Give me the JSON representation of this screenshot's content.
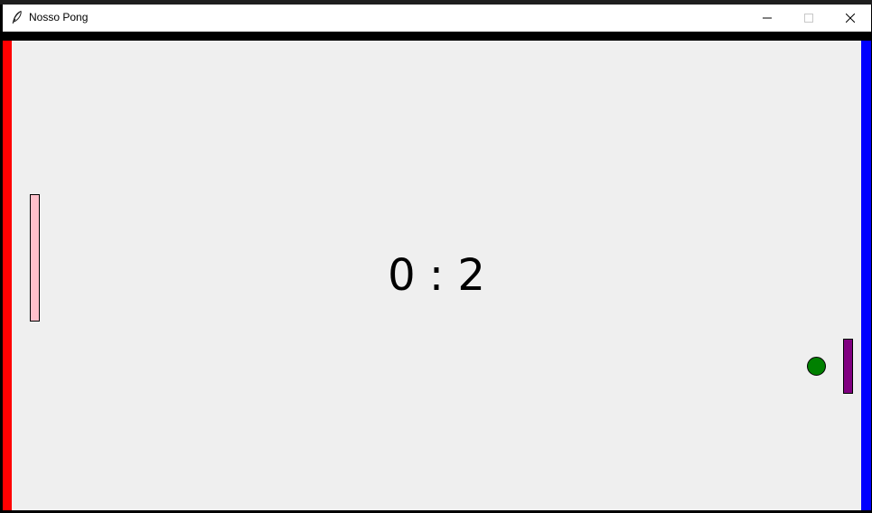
{
  "window": {
    "title": "Nosso Pong",
    "icon": "feather-icon",
    "controls": {
      "minimize_icon": "minimize-icon",
      "maximize_icon": "maximize-icon",
      "close_icon": "close-icon"
    }
  },
  "game": {
    "score": "0 : 2",
    "colors": {
      "background": "#efefef",
      "left_wall": "#ff0000",
      "right_wall": "#0000ff",
      "left_paddle": "#ffc0cb",
      "right_paddle": "#800080",
      "ball": "#008000"
    }
  }
}
